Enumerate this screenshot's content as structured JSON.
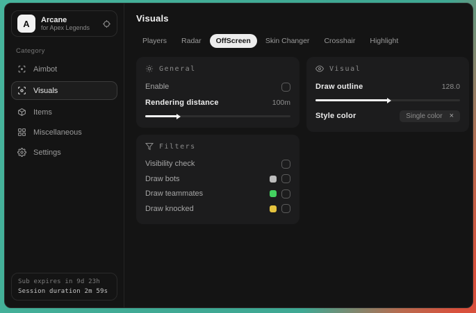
{
  "colors": {
    "background_teal": "#3fa893",
    "background_red": "#d9503c",
    "tab_active_bg": "#ededed",
    "slider_fill": "#f5f5f5"
  },
  "sidebar": {
    "app_name": "Arcane",
    "app_subtitle": "for Apex Legends",
    "logo_letter": "A",
    "category_label": "Category",
    "nav_items": [
      {
        "label": "Aimbot",
        "icon": "crosshair-icon",
        "active": false
      },
      {
        "label": "Visuals",
        "icon": "scan-eye-icon",
        "active": true
      },
      {
        "label": "Items",
        "icon": "box-icon",
        "active": false
      },
      {
        "label": "Miscellaneous",
        "icon": "grid-icon",
        "active": false
      },
      {
        "label": "Settings",
        "icon": "gear-icon",
        "active": false
      }
    ],
    "footer": {
      "sub_expires": "Sub expires in 9d 23h",
      "session_duration": "Session duration 2m 59s"
    }
  },
  "main": {
    "title": "Visuals",
    "tabs": [
      {
        "label": "Players",
        "active": false
      },
      {
        "label": "Radar",
        "active": false
      },
      {
        "label": "OffScreen",
        "active": true
      },
      {
        "label": "Skin Changer",
        "active": false
      },
      {
        "label": "Crosshair",
        "active": false
      },
      {
        "label": "Highlight",
        "active": false
      }
    ],
    "general_panel": {
      "title": "General",
      "enable_label": "Enable",
      "enable_checked": false,
      "rendering_distance_label": "Rendering distance",
      "rendering_distance_value": "100m",
      "rendering_distance_percent": 22
    },
    "filters_panel": {
      "title": "Filters",
      "rows": [
        {
          "label": "Visibility check",
          "checked": false
        },
        {
          "label": "Draw bots",
          "swatch": "#bdbdbd",
          "checked": false
        },
        {
          "label": "Draw teammates",
          "swatch": "#43d05f",
          "checked": false
        },
        {
          "label": "Draw knocked",
          "swatch": "#e5c33e",
          "checked": false
        }
      ]
    },
    "visual_panel": {
      "title": "Visual",
      "draw_outline_label": "Draw outline",
      "draw_outline_value": "128.0",
      "draw_outline_percent": 50,
      "style_color_label": "Style color",
      "style_color_value": "Single color",
      "clear_icon": "×"
    }
  }
}
